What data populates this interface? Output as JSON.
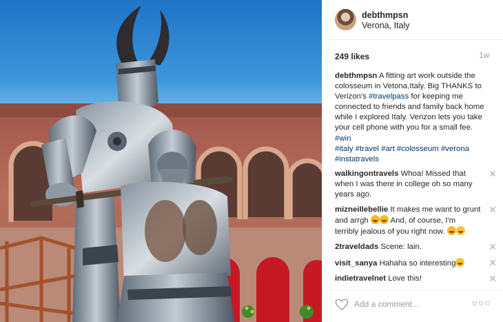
{
  "post": {
    "username": "debthmpsn",
    "location": "Verona, Italy",
    "likes": "249 likes",
    "time": "1w",
    "caption": {
      "user": "debthmpsn",
      "text_1": " A fitting art work outside the colosseum in Vetona,Italy. Big THANKS to Verizon's ",
      "tag_travelpass": "#travelpass",
      "text_2": " for keeping me connected to friends and family back home while I explored Italy. Verizon lets you take your cell phone with you for a small fee. ",
      "tag_win": "#win",
      "tags": "#italy #travel #art #colosseum #verona #instatravels"
    },
    "comments": [
      {
        "user": "walkingontravels",
        "text": " Whoa! Missed that when I was there in college oh so many years ago."
      },
      {
        "user": "mizneillebellie",
        "text": " It makes me want to grunt and arrgh ",
        "text_b": " And, of course, I'm terribly jealous of you right now. "
      },
      {
        "user": "2traveldads",
        "text": " Scene: lain."
      },
      {
        "user": "visit_sanya",
        "text": " Hahaha so interesting"
      },
      {
        "user": "indietravelnet",
        "text": " Love this!"
      }
    ],
    "close_glyph": "✕",
    "add_comment_placeholder": "Add a comment...",
    "more_glyph": "○○○"
  },
  "colors": {
    "tag": "#003569",
    "muted": "#999999",
    "sky": "#2d86d2"
  },
  "icons": [
    "heart-icon",
    "close-icon",
    "more-options-icon",
    "emoji-icon"
  ]
}
